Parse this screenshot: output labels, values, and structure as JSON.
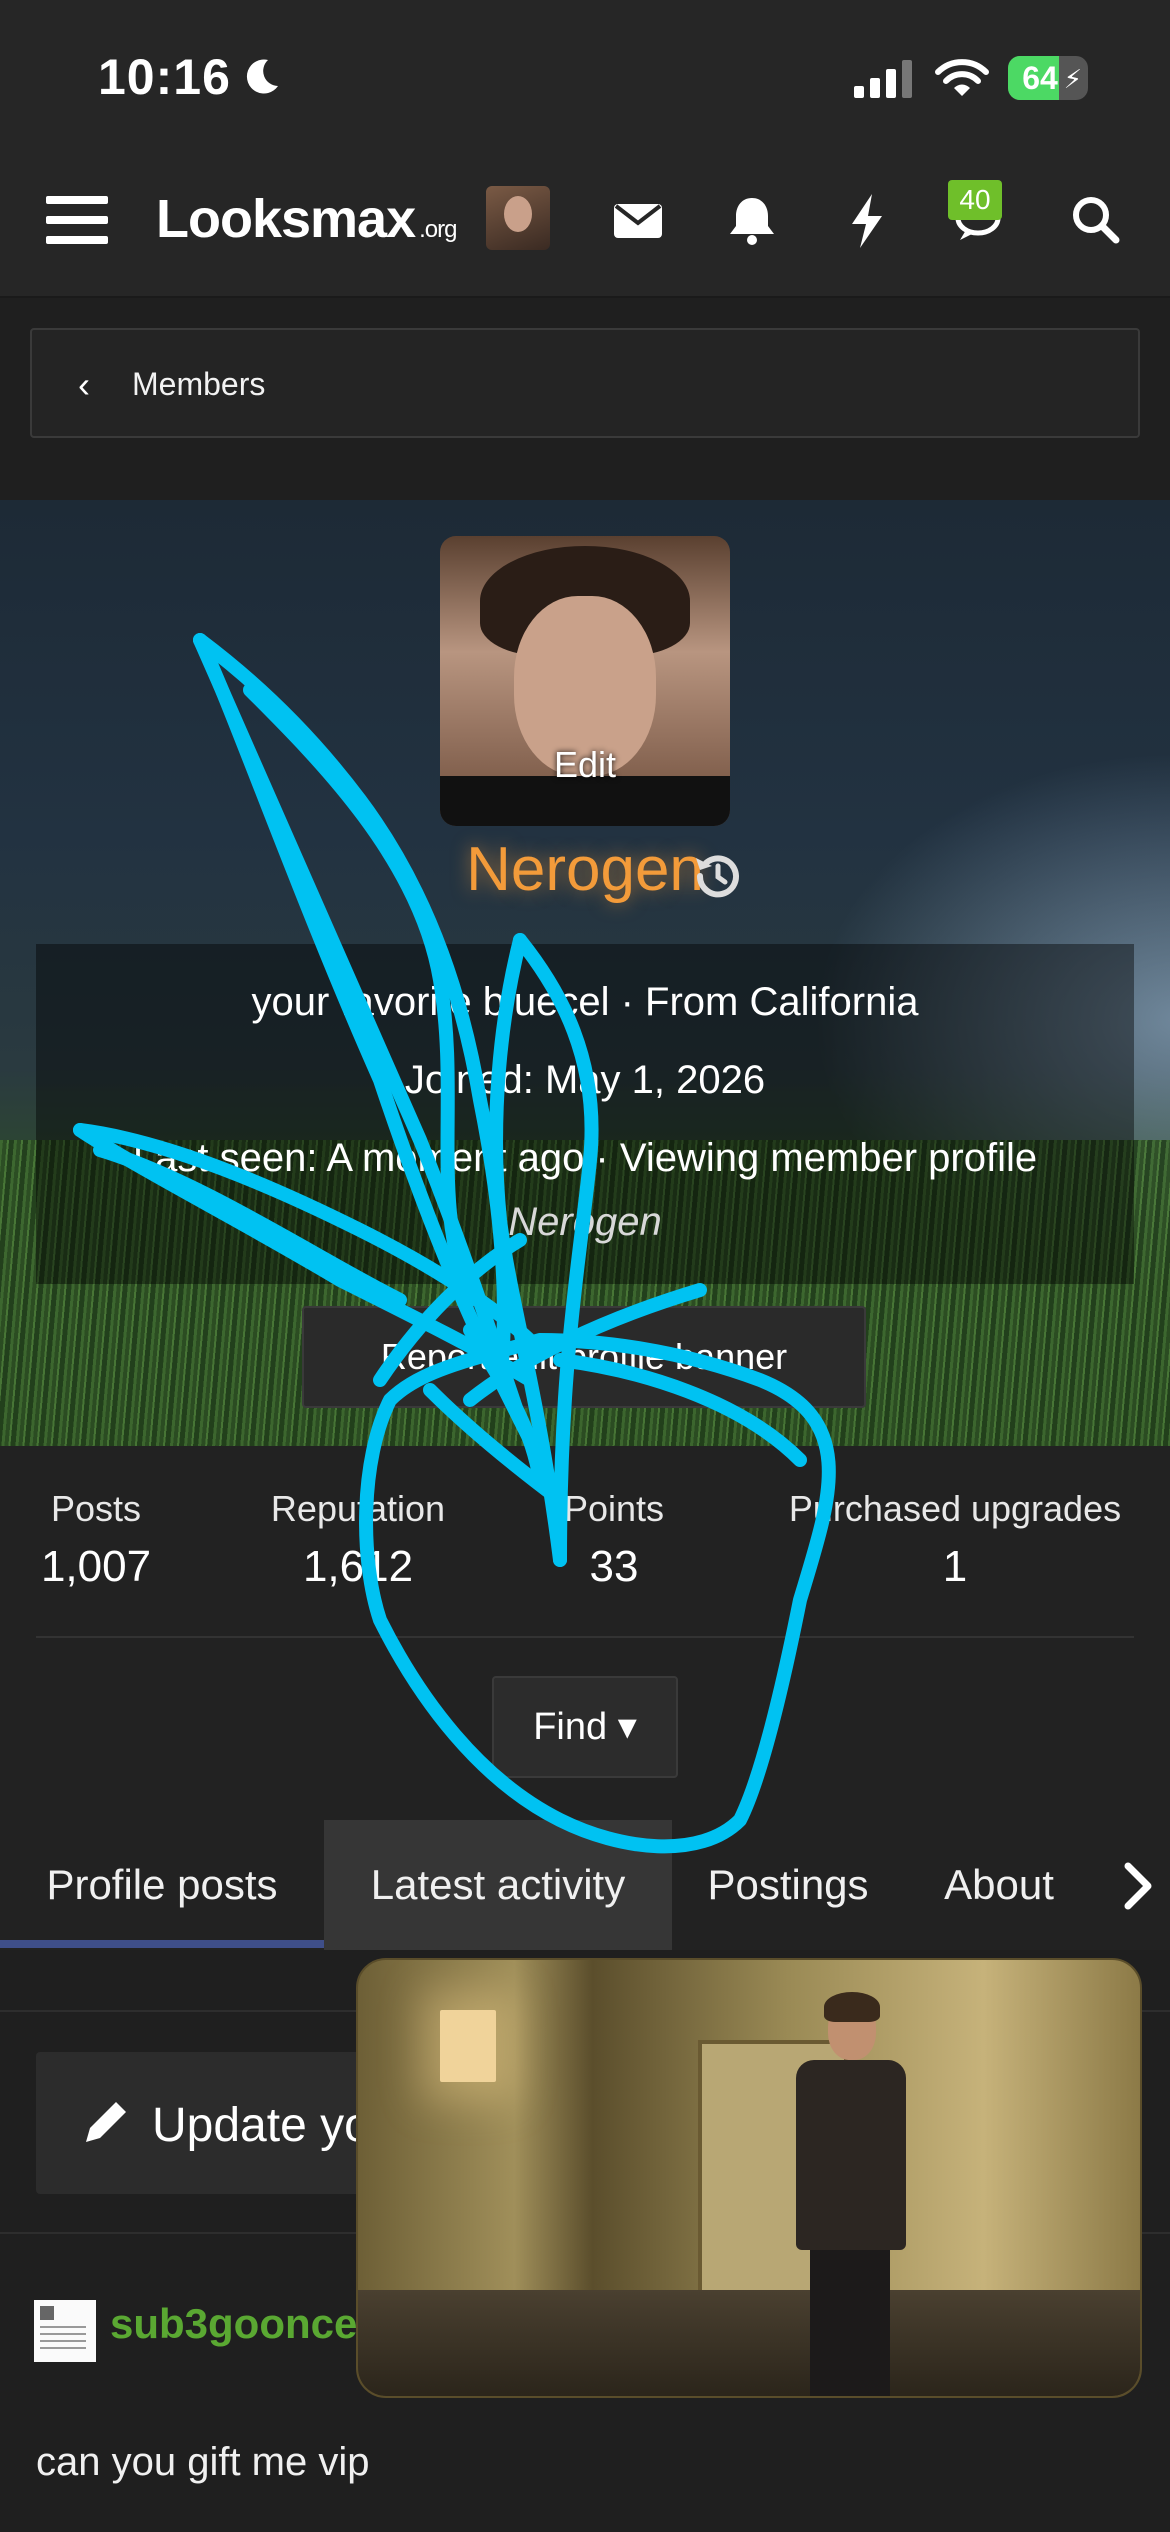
{
  "status_bar": {
    "time": "10:16",
    "battery": "64"
  },
  "nav": {
    "logo_main": "Looksmax",
    "logo_suffix": ".org",
    "chat_badge": "40"
  },
  "breadcrumb": {
    "label": "Members"
  },
  "profile": {
    "avatar_edit_label": "Edit",
    "username": "Nerogen",
    "info_line_1": "your favorite bluecel · From California",
    "info_line_2": "Joined: May 1, 2026",
    "info_line_3": "Last seen: A moment ago · Viewing member profile",
    "info_line_4": "Nerogen",
    "report_button": "Report edit profile banner"
  },
  "stats": [
    {
      "label": "Posts",
      "value": "1,007"
    },
    {
      "label": "Reputation",
      "value": "1,612"
    },
    {
      "label": "Points",
      "value": "33"
    },
    {
      "label": "Purchased upgrades",
      "value": "1"
    }
  ],
  "find_button": "Find",
  "tabs": [
    {
      "label": "Profile posts"
    },
    {
      "label": "Latest activity"
    },
    {
      "label": "Postings"
    },
    {
      "label": "About"
    }
  ],
  "content": {
    "update_button": "Update your status...",
    "post_author": "sub3gooncel",
    "post_text": "can you gift me vip"
  },
  "colors": {
    "username": "#f39b3a",
    "author": "#5aa832",
    "scribble": "#00c2f2",
    "badge": "#6fbf2a",
    "tab_underline": "#3f4f8a"
  }
}
